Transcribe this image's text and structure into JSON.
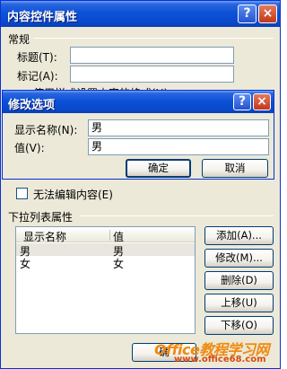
{
  "main": {
    "title": "内容控件属性",
    "help_glyph": "?",
    "close_glyph": "×",
    "general_group": "常规",
    "title_label": "标题(T):",
    "tag_label": "标记(A):",
    "style_checkbox_label": "使用样式设置内容的格式(U)",
    "locked_group_hidden": "",
    "noedit_label": "无法编辑内容(E)",
    "dropdown_group": "下拉列表属性",
    "list_headers": [
      "显示名称",
      "值"
    ],
    "list_rows": [
      {
        "name": "男",
        "value": "男"
      },
      {
        "name": "女",
        "value": "女"
      }
    ],
    "buttons": {
      "add": "添加(A)...",
      "modify": "修改(M)...",
      "delete": "删除(D)",
      "up": "上移(U)",
      "down": "下移(O)",
      "ok_partial": "确"
    }
  },
  "modify_dialog": {
    "title": "修改选项",
    "help_glyph": "?",
    "close_glyph": "×",
    "display_name_label": "显示名称(N):",
    "display_name_value": "男",
    "value_label": "值(V):",
    "value_value": "男",
    "ok": "确定",
    "cancel": "取消"
  },
  "watermark": {
    "line1": "Office教程学习网",
    "line2": "www.office68.com"
  }
}
